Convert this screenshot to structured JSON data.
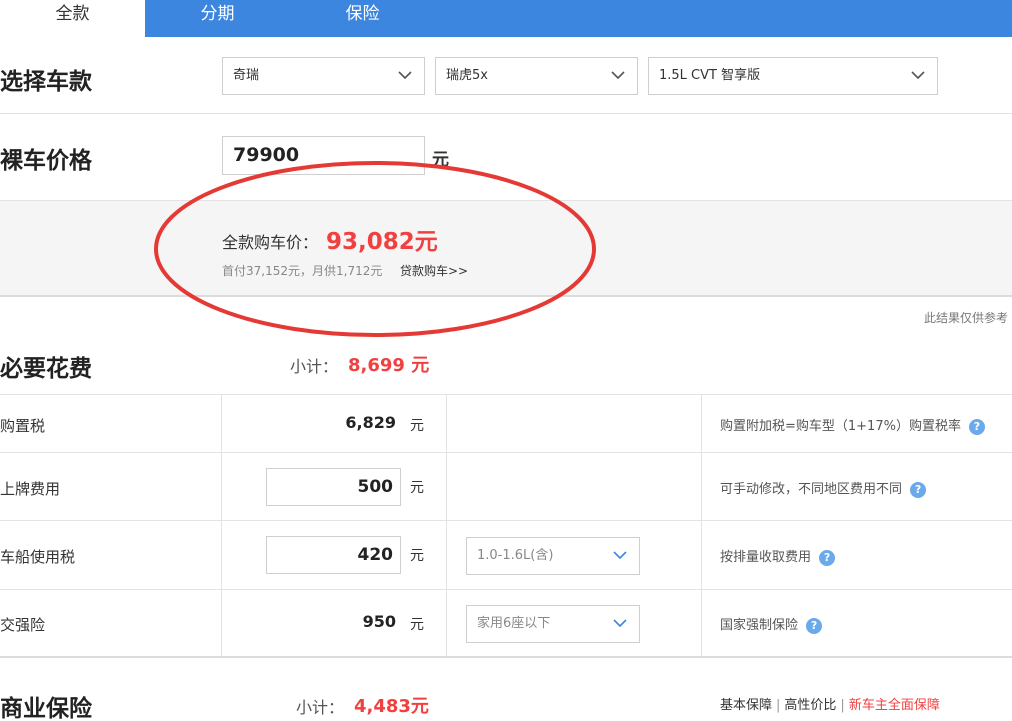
{
  "tabs": [
    {
      "label": "全款",
      "active": true
    },
    {
      "label": "分期",
      "active": false
    },
    {
      "label": "保险",
      "active": false
    }
  ],
  "select_model": {
    "title": "选择车款",
    "brand": "奇瑞",
    "series": "瑞虎5x",
    "trim": "1.5L CVT 智享版"
  },
  "bare_price": {
    "title": "裸车价格",
    "value": "79900",
    "unit": "元"
  },
  "summary": {
    "label": "全款购车价：",
    "value": "93,082元",
    "sub": "首付37,152元，月供1,712元",
    "link": "贷款购车>>",
    "annotation_color": "#e53935"
  },
  "note": "此结果仅供参考",
  "required_fees": {
    "title": "必要花费",
    "subtotal_label": "小计：",
    "subtotal_value": "8,699 元",
    "rows": [
      {
        "label": "购置税",
        "value": "6,829",
        "unit": "元",
        "editable": false,
        "select": "",
        "tip": "购置附加税=购车型（1+17%）购置税率"
      },
      {
        "label": "上牌费用",
        "value": "500",
        "unit": "元",
        "editable": true,
        "select": "",
        "tip": "可手动修改，不同地区费用不同"
      },
      {
        "label": "车船使用税",
        "value": "420",
        "unit": "元",
        "editable": true,
        "select": "1.0-1.6L(含)",
        "tip": "按排量收取费用"
      },
      {
        "label": "交强险",
        "value": "950",
        "unit": "元",
        "editable": false,
        "select": "家用6座以下",
        "tip": "国家强制保险"
      }
    ]
  },
  "commercial_insurance": {
    "title": "商业保险",
    "subtotal_label": "小计：",
    "subtotal_value": "4,483元",
    "options": [
      "基本保障",
      "高性价比",
      "新车主全面保障"
    ]
  },
  "colors": {
    "tab_bar": "#3d86e0",
    "accent_red": "#f04040",
    "help_icon": "#6aa9ea"
  }
}
